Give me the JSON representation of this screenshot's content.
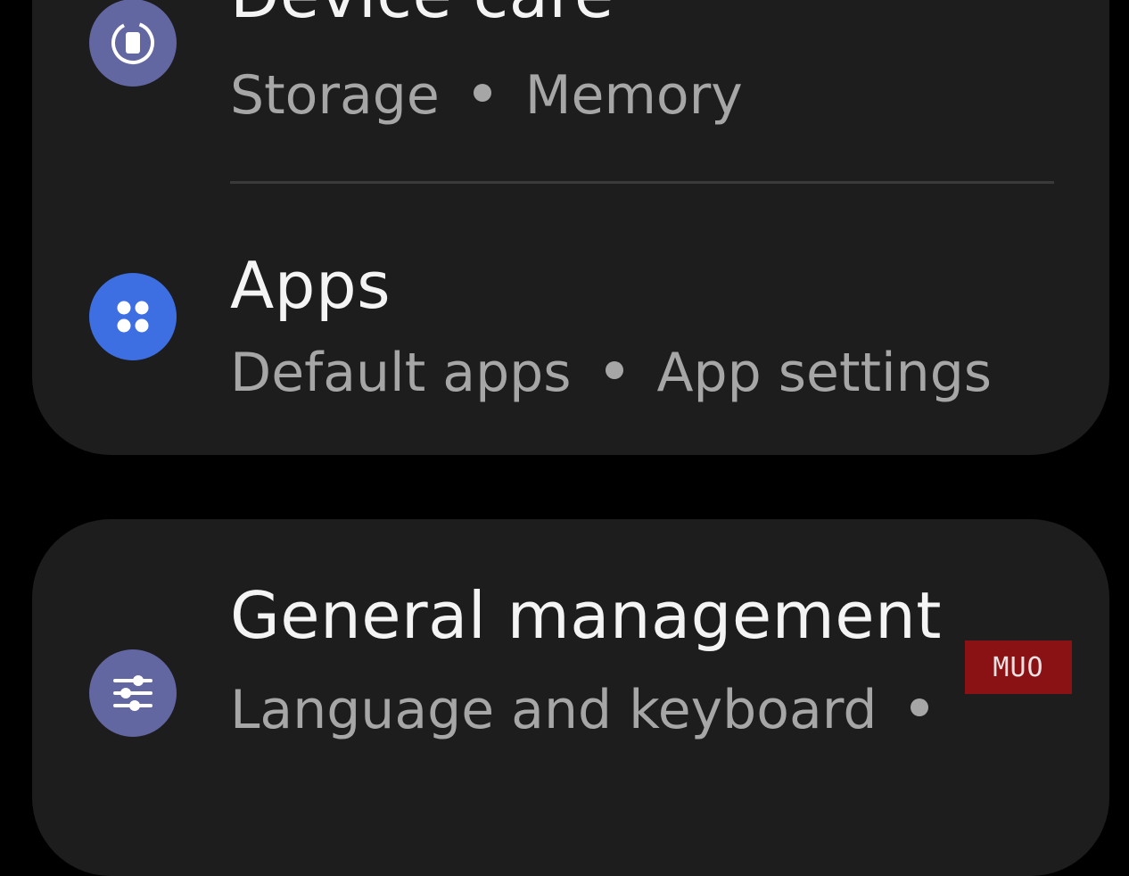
{
  "colors": {
    "background": "#000000",
    "card": "#1d1d1d",
    "device_care_icon_bg": "#6266a1",
    "apps_icon_bg": "#3d6fe3",
    "general_icon_bg": "#6266a1",
    "watermark": "#8a1214"
  },
  "settings": {
    "device_care": {
      "title": "Device care",
      "subtitle_parts": [
        "Storage",
        "Memory"
      ],
      "icon": "device-care-icon"
    },
    "apps": {
      "title": "Apps",
      "subtitle_parts": [
        "Default apps",
        "App settings"
      ],
      "icon": "apps-grid-icon"
    },
    "general_management": {
      "title": "General management",
      "subtitle_parts": [
        "Language and keyboard"
      ],
      "icon": "sliders-icon"
    }
  },
  "watermark": {
    "text": "MUO"
  }
}
